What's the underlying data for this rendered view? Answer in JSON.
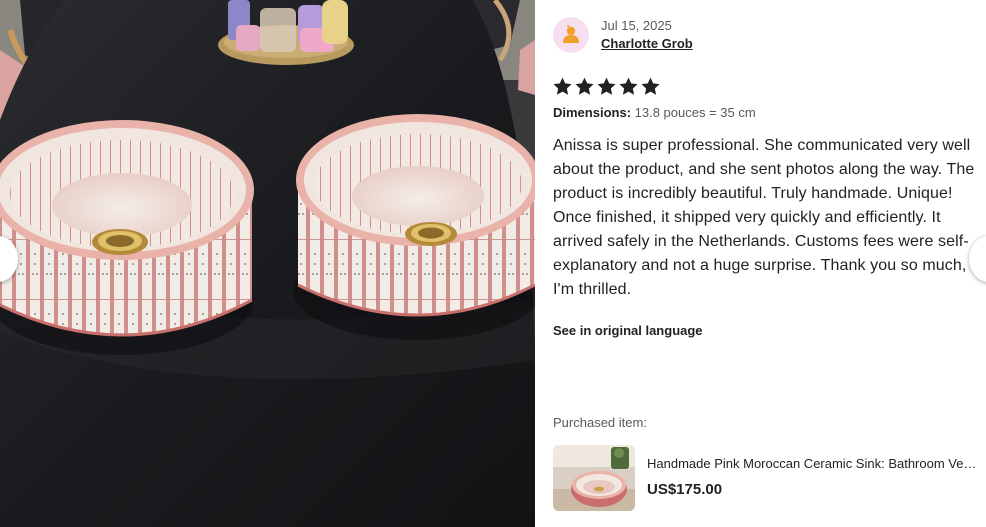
{
  "photo": {
    "image_subject": "two pink patterned ceramic sinks on a dark table"
  },
  "review": {
    "date": "Jul 15, 2025",
    "reviewer_name": "Charlotte Grob",
    "rating": 5,
    "rating_max": 5,
    "dimensions_label": "Dimensions:",
    "dimensions_value": "13.8 pouces = 35 cm",
    "text": "Anissa is super professional. She communicated very well about the product, and she sent photos along the way. The product is incredibly beautiful. Truly handmade. Unique! Once finished, it shipped very quickly and efficiently. It arrived safely in the Netherlands. Customs fees were self-explanatory and not a huge surprise. Thank you so much, I'm thrilled.",
    "translate_link": "See in original language"
  },
  "purchased": {
    "label": "Purchased item:",
    "product_title": "Handmade Pink Moroccan Ceramic Sink: Bathroom Vessel Sink",
    "price": "US$175.00"
  },
  "icons": {
    "avatar": "user-avatar-icon",
    "star": "star-icon",
    "prev": "chevron-left-icon",
    "next": "chevron-right-icon"
  },
  "colors": {
    "avatar_bg": "#f7dff0",
    "avatar_fg": "#f1a02b",
    "star": "#222222",
    "text": "#222222",
    "muted": "#595959"
  }
}
